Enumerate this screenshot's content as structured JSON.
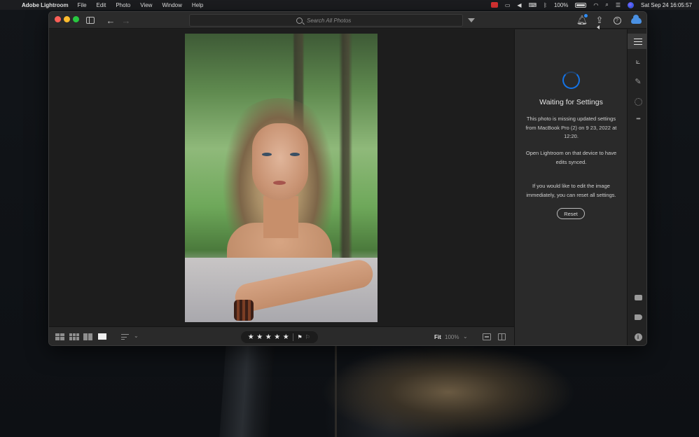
{
  "menubar": {
    "apple_glyph": "",
    "app_name": "Adobe Lightroom",
    "menus": [
      "File",
      "Edit",
      "Photo",
      "View",
      "Window",
      "Help"
    ],
    "battery": "100%",
    "datetime": "Sat Sep 24  16:05:57"
  },
  "titlebar": {
    "search_placeholder": "Search All Photos"
  },
  "panel": {
    "title": "Waiting for Settings",
    "message1": "This photo is missing updated settings from MacBook Pro (2) on 9 23, 2022 at 12:20.",
    "message2": "Open Lightroom on that device to have edits synced.",
    "message3": "If you would like to edit the image immediately, you can reset all settings.",
    "reset_label": "Reset",
    "accent": "#1473e6"
  },
  "toolstrip": {
    "tools": [
      "edit-icon",
      "crop-icon",
      "healing-icon",
      "masking-icon",
      "more-icon",
      "comments-icon",
      "keywords-icon",
      "info-icon"
    ],
    "more_glyph": "•••",
    "info_glyph": "i"
  },
  "bottombar": {
    "stars": [
      "★",
      "★",
      "★",
      "★",
      "★"
    ],
    "flag_pick": "⚑",
    "flag_reject": "⚐",
    "fit_label": "Fit",
    "zoom_value": "100%",
    "chevron": "⌄"
  }
}
